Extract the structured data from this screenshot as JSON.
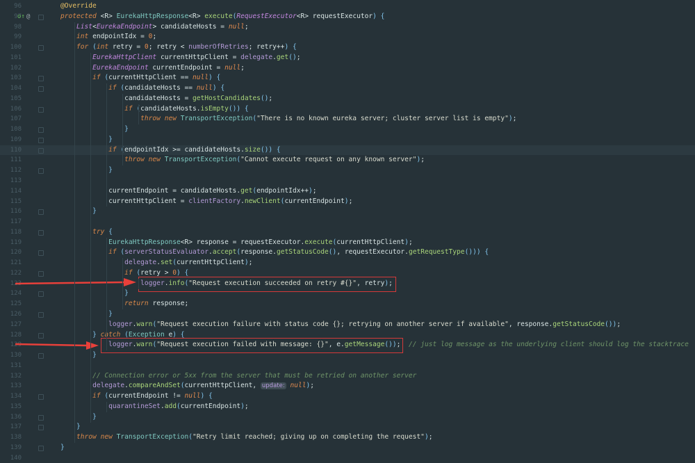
{
  "editor": {
    "current_line": 110,
    "inlay_hint": "update:",
    "gutter_icons": {
      "line": 97,
      "override_icon": "o↑",
      "annotation_icon": "@"
    },
    "lines": [
      {
        "n": 96,
        "tokens": [
          [
            "an",
            "@Override"
          ]
        ]
      },
      {
        "n": 97,
        "tokens": [
          [
            "k",
            "protected "
          ],
          [
            "p",
            "<R> "
          ],
          [
            "c",
            "EurekaHttpResponse"
          ],
          [
            "p",
            "<R> "
          ],
          [
            "m",
            "execute"
          ],
          [
            "pu",
            "("
          ],
          [
            "t",
            "RequestExecutor"
          ],
          [
            "p",
            "<R> requestExecutor"
          ],
          [
            "pu",
            ") {"
          ]
        ]
      },
      {
        "n": 98,
        "tokens": [
          [
            "p",
            "    "
          ],
          [
            "t",
            "List"
          ],
          [
            "p",
            "<"
          ],
          [
            "t",
            "EurekaEndpoint"
          ],
          [
            "p",
            "> candidateHosts = "
          ],
          [
            "n",
            "null"
          ],
          [
            "p",
            ";"
          ]
        ]
      },
      {
        "n": 99,
        "tokens": [
          [
            "p",
            "    "
          ],
          [
            "k",
            "int "
          ],
          [
            "p",
            "endpointIdx = "
          ],
          [
            "num",
            "0"
          ],
          [
            "p",
            ";"
          ]
        ]
      },
      {
        "n": 100,
        "tokens": [
          [
            "p",
            "    "
          ],
          [
            "k",
            "for "
          ],
          [
            "pu",
            "("
          ],
          [
            "k",
            "int "
          ],
          [
            "p",
            "retry = "
          ],
          [
            "num",
            "0"
          ],
          [
            "p",
            "; retry < "
          ],
          [
            "f",
            "numberOfRetries"
          ],
          [
            "p",
            "; retry++"
          ],
          [
            "pu",
            ") {"
          ]
        ]
      },
      {
        "n": 101,
        "tokens": [
          [
            "p",
            "        "
          ],
          [
            "t",
            "EurekaHttpClient "
          ],
          [
            "p",
            "currentHttpClient = "
          ],
          [
            "f",
            "delegate"
          ],
          [
            "p",
            "."
          ],
          [
            "m",
            "get"
          ],
          [
            "pu",
            "()"
          ],
          [
            "p",
            ";"
          ]
        ]
      },
      {
        "n": 102,
        "tokens": [
          [
            "p",
            "        "
          ],
          [
            "t",
            "EurekaEndpoint "
          ],
          [
            "p",
            "currentEndpoint = "
          ],
          [
            "n",
            "null"
          ],
          [
            "p",
            ";"
          ]
        ]
      },
      {
        "n": 103,
        "tokens": [
          [
            "p",
            "        "
          ],
          [
            "k",
            "if "
          ],
          [
            "pu",
            "("
          ],
          [
            "p",
            "currentHttpClient == "
          ],
          [
            "n",
            "null"
          ],
          [
            "pu",
            ") {"
          ]
        ]
      },
      {
        "n": 104,
        "tokens": [
          [
            "p",
            "            "
          ],
          [
            "k",
            "if "
          ],
          [
            "pu",
            "("
          ],
          [
            "p",
            "candidateHosts == "
          ],
          [
            "n",
            "null"
          ],
          [
            "pu",
            ") {"
          ]
        ]
      },
      {
        "n": 105,
        "tokens": [
          [
            "p",
            "                candidateHosts = "
          ],
          [
            "m",
            "getHostCandidates"
          ],
          [
            "pu",
            "()"
          ],
          [
            "p",
            ";"
          ]
        ]
      },
      {
        "n": 106,
        "tokens": [
          [
            "p",
            "                "
          ],
          [
            "k",
            "if "
          ],
          [
            "pu",
            "("
          ],
          [
            "p",
            "candidateHosts."
          ],
          [
            "m",
            "isEmpty"
          ],
          [
            "pu",
            "()) {"
          ]
        ]
      },
      {
        "n": 107,
        "tokens": [
          [
            "p",
            "                    "
          ],
          [
            "k",
            "throw new "
          ],
          [
            "c",
            "TransportException"
          ],
          [
            "pu",
            "("
          ],
          [
            "s",
            "\"There is no known eureka server; cluster server list is empty\""
          ],
          [
            "pu",
            ")"
          ],
          [
            "p",
            ";"
          ]
        ]
      },
      {
        "n": 108,
        "tokens": [
          [
            "p",
            "                "
          ],
          [
            "pu",
            "}"
          ]
        ]
      },
      {
        "n": 109,
        "tokens": [
          [
            "p",
            "            "
          ],
          [
            "pu",
            "}"
          ]
        ]
      },
      {
        "n": 110,
        "tokens": [
          [
            "p",
            "            "
          ],
          [
            "k",
            "if "
          ],
          [
            "pu",
            "("
          ],
          [
            "p",
            "endpointIdx >= candidateHosts."
          ],
          [
            "m",
            "size"
          ],
          [
            "pu",
            "()) {"
          ]
        ]
      },
      {
        "n": 111,
        "tokens": [
          [
            "p",
            "                "
          ],
          [
            "k",
            "throw new "
          ],
          [
            "c",
            "TransportException"
          ],
          [
            "pu",
            "("
          ],
          [
            "s",
            "\"Cannot execute request on any known server\""
          ],
          [
            "pu",
            ")"
          ],
          [
            "p",
            ";"
          ]
        ]
      },
      {
        "n": 112,
        "tokens": [
          [
            "p",
            "            "
          ],
          [
            "pu",
            "}"
          ]
        ]
      },
      {
        "n": 113,
        "tokens": []
      },
      {
        "n": 114,
        "tokens": [
          [
            "p",
            "            currentEndpoint = candidateHosts."
          ],
          [
            "m",
            "get"
          ],
          [
            "pu",
            "("
          ],
          [
            "p",
            "endpointIdx++"
          ],
          [
            "pu",
            ")"
          ],
          [
            "p",
            ";"
          ]
        ]
      },
      {
        "n": 115,
        "tokens": [
          [
            "p",
            "            currentHttpClient = "
          ],
          [
            "f",
            "clientFactory"
          ],
          [
            "p",
            "."
          ],
          [
            "m",
            "newClient"
          ],
          [
            "pu",
            "("
          ],
          [
            "p",
            "currentEndpoint"
          ],
          [
            "pu",
            ")"
          ],
          [
            "p",
            ";"
          ]
        ]
      },
      {
        "n": 116,
        "tokens": [
          [
            "p",
            "        "
          ],
          [
            "pu",
            "}"
          ]
        ]
      },
      {
        "n": 117,
        "tokens": []
      },
      {
        "n": 118,
        "tokens": [
          [
            "p",
            "        "
          ],
          [
            "k",
            "try "
          ],
          [
            "pu",
            "{"
          ]
        ]
      },
      {
        "n": 119,
        "tokens": [
          [
            "p",
            "            "
          ],
          [
            "c",
            "EurekaHttpResponse"
          ],
          [
            "p",
            "<R> response = requestExecutor."
          ],
          [
            "m",
            "execute"
          ],
          [
            "pu",
            "("
          ],
          [
            "p",
            "currentHttpClient"
          ],
          [
            "pu",
            ")"
          ],
          [
            "p",
            ";"
          ]
        ]
      },
      {
        "n": 120,
        "tokens": [
          [
            "p",
            "            "
          ],
          [
            "k",
            "if "
          ],
          [
            "pu",
            "("
          ],
          [
            "f",
            "serverStatusEvaluator"
          ],
          [
            "p",
            "."
          ],
          [
            "m",
            "accept"
          ],
          [
            "pu",
            "("
          ],
          [
            "p",
            "response."
          ],
          [
            "m",
            "getStatusCode"
          ],
          [
            "pu",
            "()"
          ],
          [
            "p",
            ", requestExecutor."
          ],
          [
            "m",
            "getRequestType"
          ],
          [
            "pu",
            "())) {"
          ]
        ]
      },
      {
        "n": 121,
        "tokens": [
          [
            "p",
            "                "
          ],
          [
            "f",
            "delegate"
          ],
          [
            "p",
            "."
          ],
          [
            "m",
            "set"
          ],
          [
            "pu",
            "("
          ],
          [
            "p",
            "currentHttpClient"
          ],
          [
            "pu",
            ")"
          ],
          [
            "p",
            ";"
          ]
        ]
      },
      {
        "n": 122,
        "tokens": [
          [
            "p",
            "                "
          ],
          [
            "k",
            "if "
          ],
          [
            "pu",
            "("
          ],
          [
            "p",
            "retry > "
          ],
          [
            "num",
            "0"
          ],
          [
            "pu",
            ") {"
          ]
        ]
      },
      {
        "n": 123,
        "tokens": [
          [
            "p",
            "                    "
          ],
          [
            "f",
            "logger"
          ],
          [
            "p",
            "."
          ],
          [
            "m",
            "info"
          ],
          [
            "pu",
            "("
          ],
          [
            "s",
            "\"Request execution succeeded on retry #{}\""
          ],
          [
            "p",
            ", retry"
          ],
          [
            "pu",
            ")"
          ],
          [
            "p",
            ";"
          ]
        ]
      },
      {
        "n": 124,
        "tokens": [
          [
            "p",
            "                "
          ],
          [
            "pu",
            "}"
          ]
        ]
      },
      {
        "n": 125,
        "tokens": [
          [
            "p",
            "                "
          ],
          [
            "k",
            "return "
          ],
          [
            "p",
            "response;"
          ]
        ]
      },
      {
        "n": 126,
        "tokens": [
          [
            "p",
            "            "
          ],
          [
            "pu",
            "}"
          ]
        ]
      },
      {
        "n": 127,
        "tokens": [
          [
            "p",
            "            "
          ],
          [
            "f",
            "logger"
          ],
          [
            "p",
            "."
          ],
          [
            "m",
            "warn"
          ],
          [
            "pu",
            "("
          ],
          [
            "s",
            "\"Request execution failure with status code {}; retrying on another server if available\""
          ],
          [
            "p",
            ", response."
          ],
          [
            "m",
            "getStatusCode"
          ],
          [
            "pu",
            "())"
          ],
          [
            "p",
            ";"
          ]
        ]
      },
      {
        "n": 128,
        "tokens": [
          [
            "p",
            "        "
          ],
          [
            "pu",
            "} "
          ],
          [
            "k",
            "catch "
          ],
          [
            "pu",
            "("
          ],
          [
            "c",
            "Exception"
          ],
          [
            "p",
            " e"
          ],
          [
            "pu",
            ") {"
          ]
        ]
      },
      {
        "n": 129,
        "tokens": [
          [
            "p",
            "            "
          ],
          [
            "f",
            "logger"
          ],
          [
            "p",
            "."
          ],
          [
            "m",
            "warn"
          ],
          [
            "pu",
            "("
          ],
          [
            "s",
            "\"Request execution failed with message: {}\""
          ],
          [
            "p",
            ", e."
          ],
          [
            "m",
            "getMessage"
          ],
          [
            "pu",
            "())"
          ],
          [
            "p",
            ";  "
          ],
          [
            "cm",
            "// just log message as the underlying client should log the stacktrace"
          ]
        ]
      },
      {
        "n": 130,
        "tokens": [
          [
            "p",
            "        "
          ],
          [
            "pu",
            "}"
          ]
        ]
      },
      {
        "n": 131,
        "tokens": []
      },
      {
        "n": 132,
        "tokens": [
          [
            "p",
            "        "
          ],
          [
            "cm",
            "// Connection error or 5xx from the server that must be retried on another server"
          ]
        ]
      },
      {
        "n": 133,
        "tokens": [
          [
            "p",
            "        "
          ],
          [
            "f",
            "delegate"
          ],
          [
            "p",
            "."
          ],
          [
            "m",
            "compareAndSet"
          ],
          [
            "pu",
            "("
          ],
          [
            "p",
            "currentHttpClient, "
          ],
          [
            "hint",
            "update:"
          ],
          [
            "p",
            " "
          ],
          [
            "n",
            "null"
          ],
          [
            "pu",
            ")"
          ],
          [
            "p",
            ";"
          ]
        ]
      },
      {
        "n": 134,
        "tokens": [
          [
            "p",
            "        "
          ],
          [
            "k",
            "if "
          ],
          [
            "pu",
            "("
          ],
          [
            "p",
            "currentEndpoint != "
          ],
          [
            "n",
            "null"
          ],
          [
            "pu",
            ") {"
          ]
        ]
      },
      {
        "n": 135,
        "tokens": [
          [
            "p",
            "            "
          ],
          [
            "f",
            "quarantineSet"
          ],
          [
            "p",
            "."
          ],
          [
            "m",
            "add"
          ],
          [
            "pu",
            "("
          ],
          [
            "p",
            "currentEndpoint"
          ],
          [
            "pu",
            ")"
          ],
          [
            "p",
            ";"
          ]
        ]
      },
      {
        "n": 136,
        "tokens": [
          [
            "p",
            "        "
          ],
          [
            "pu",
            "}"
          ]
        ]
      },
      {
        "n": 137,
        "tokens": [
          [
            "p",
            "    "
          ],
          [
            "pu",
            "}"
          ]
        ]
      },
      {
        "n": 138,
        "tokens": [
          [
            "p",
            "    "
          ],
          [
            "k",
            "throw new "
          ],
          [
            "c",
            "TransportException"
          ],
          [
            "pu",
            "("
          ],
          [
            "s",
            "\"Retry limit reached; giving up on completing the request\""
          ],
          [
            "pu",
            ")"
          ],
          [
            "p",
            ";"
          ]
        ]
      },
      {
        "n": 139,
        "tokens": [
          [
            "pu",
            "}"
          ]
        ]
      },
      {
        "n": 140,
        "tokens": []
      }
    ],
    "fold_lines": [
      97,
      100,
      103,
      104,
      106,
      108,
      109,
      110,
      112,
      116,
      118,
      120,
      122,
      124,
      126,
      128,
      130,
      134,
      136,
      137,
      139
    ]
  },
  "annotations": {
    "highlight_color": "#d63a3a",
    "highlighted_lines": [
      123,
      129
    ]
  }
}
